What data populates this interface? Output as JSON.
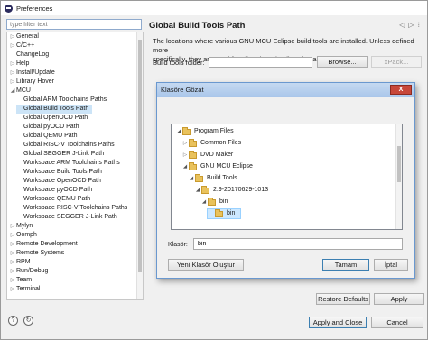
{
  "window": {
    "title": "Preferences"
  },
  "filter": {
    "placeholder": "type filter text"
  },
  "tree": [
    {
      "label": "General",
      "level": 0,
      "arrow": "collapsed"
    },
    {
      "label": "C/C++",
      "level": 0,
      "arrow": "collapsed"
    },
    {
      "label": "ChangeLog",
      "level": 0,
      "arrow": "none"
    },
    {
      "label": "Help",
      "level": 0,
      "arrow": "collapsed"
    },
    {
      "label": "Install/Update",
      "level": 0,
      "arrow": "collapsed"
    },
    {
      "label": "Library Hover",
      "level": 0,
      "arrow": "collapsed"
    },
    {
      "label": "MCU",
      "level": 0,
      "arrow": "expanded"
    },
    {
      "label": "Global ARM Toolchains Paths",
      "level": 1,
      "arrow": "none"
    },
    {
      "label": "Global Build Tools Path",
      "level": 1,
      "arrow": "none",
      "selected": true
    },
    {
      "label": "Global OpenOCD Path",
      "level": 1,
      "arrow": "none"
    },
    {
      "label": "Global pyOCD Path",
      "level": 1,
      "arrow": "none"
    },
    {
      "label": "Global QEMU Path",
      "level": 1,
      "arrow": "none"
    },
    {
      "label": "Global RISC-V Toolchains Paths",
      "level": 1,
      "arrow": "none"
    },
    {
      "label": "Global SEGGER J-Link Path",
      "level": 1,
      "arrow": "none"
    },
    {
      "label": "Workspace ARM Toolchains Paths",
      "level": 1,
      "arrow": "none"
    },
    {
      "label": "Workspace Build Tools Path",
      "level": 1,
      "arrow": "none"
    },
    {
      "label": "Workspace OpenOCD Path",
      "level": 1,
      "arrow": "none"
    },
    {
      "label": "Workspace pyOCD Path",
      "level": 1,
      "arrow": "none"
    },
    {
      "label": "Workspace QEMU Path",
      "level": 1,
      "arrow": "none"
    },
    {
      "label": "Workspace RISC-V Toolchains Paths",
      "level": 1,
      "arrow": "none"
    },
    {
      "label": "Workspace SEGGER J-Link Path",
      "level": 1,
      "arrow": "none"
    },
    {
      "label": "Mylyn",
      "level": 0,
      "arrow": "collapsed"
    },
    {
      "label": "Oomph",
      "level": 0,
      "arrow": "collapsed"
    },
    {
      "label": "Remote Development",
      "level": 0,
      "arrow": "collapsed"
    },
    {
      "label": "Remote Systems",
      "level": 0,
      "arrow": "collapsed"
    },
    {
      "label": "RPM",
      "level": 0,
      "arrow": "collapsed"
    },
    {
      "label": "Run/Debug",
      "level": 0,
      "arrow": "collapsed"
    },
    {
      "label": "Team",
      "level": 0,
      "arrow": "collapsed"
    },
    {
      "label": "Terminal",
      "level": 0,
      "arrow": "collapsed"
    }
  ],
  "page": {
    "title": "Global Build Tools Path",
    "description_1": "The locations where various GNU MCU Eclipse build tools are installed. Unless defined more",
    "description_2": "specifically, they are used for all projects in all workspaces.",
    "folder_label": "Build tools folder:",
    "browse_label": "Browse...",
    "xpack_label": "xPack..."
  },
  "dialog": {
    "title": "Klasöre Gözat",
    "close_glyph": "X",
    "folders": [
      {
        "label": "Program Files",
        "level": 0,
        "arrow": "expanded"
      },
      {
        "label": "Common Files",
        "level": 1,
        "arrow": "collapsed"
      },
      {
        "label": "DVD Maker",
        "level": 1,
        "arrow": "collapsed"
      },
      {
        "label": "GNU MCU Eclipse",
        "level": 1,
        "arrow": "expanded"
      },
      {
        "label": "Build Tools",
        "level": 2,
        "arrow": "expanded"
      },
      {
        "label": "2.9-20170629-1013",
        "level": 3,
        "arrow": "expanded"
      },
      {
        "label": "bin",
        "level": 4,
        "arrow": "expanded"
      },
      {
        "label": "bin",
        "level": 5,
        "arrow": "none",
        "selected": true
      }
    ],
    "folder_label": "Klasör:",
    "folder_value": "bin",
    "new_folder_label": "Yeni Klasör Oluştur",
    "ok_label": "Tamam",
    "cancel_label": "İptal"
  },
  "footer": {
    "restore_label": "Restore Defaults",
    "apply_label": "Apply",
    "apply_close_label": "Apply and Close",
    "cancel_label": "Cancel",
    "help_glyph": "?",
    "import_glyph": "↻"
  },
  "icons": {
    "tree_expanded": "◢",
    "tree_collapsed": "▷",
    "nav_back": "◁",
    "nav_forward": "▷",
    "nav_menu": "⁝",
    "dialog_expanded": "◢",
    "dialog_collapsed": "▷"
  }
}
